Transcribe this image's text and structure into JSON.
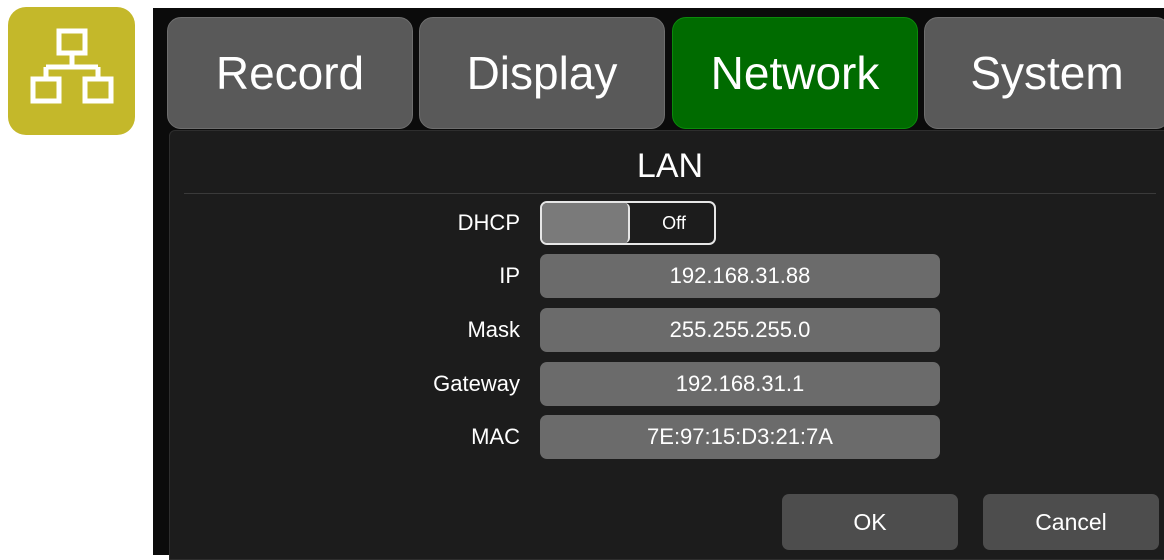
{
  "icon": {
    "name": "network-icon",
    "color": "#c4b82a"
  },
  "tabs": [
    {
      "label": "Record",
      "active": false
    },
    {
      "label": "Display",
      "active": false
    },
    {
      "label": "Network",
      "active": true
    },
    {
      "label": "System",
      "active": false
    }
  ],
  "panel": {
    "title": "LAN",
    "dhcp": {
      "label": "DHCP",
      "value": "Off"
    },
    "ip": {
      "label": "IP",
      "value": "192.168.31.88"
    },
    "mask": {
      "label": "Mask",
      "value": "255.255.255.0"
    },
    "gateway": {
      "label": "Gateway",
      "value": "192.168.31.1"
    },
    "mac": {
      "label": "MAC",
      "value": "7E:97:15:D3:21:7A"
    }
  },
  "buttons": {
    "ok": "OK",
    "cancel": "Cancel"
  },
  "colors": {
    "active_tab": "#006b00",
    "inactive_tab": "#595959",
    "field": "#6b6b6b"
  }
}
